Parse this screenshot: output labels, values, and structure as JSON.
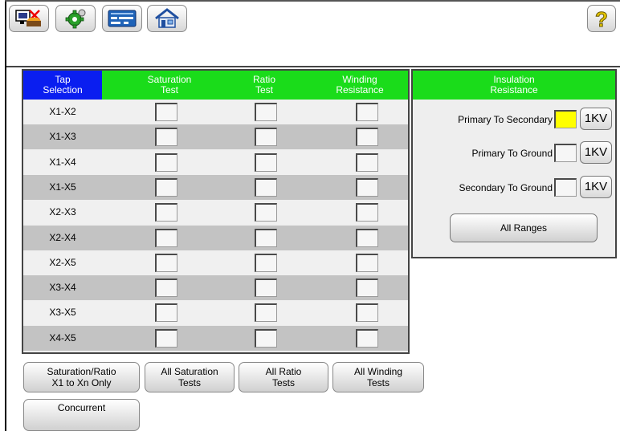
{
  "toolbar": {
    "buttons": [
      {
        "icon": "test-unit-icon"
      },
      {
        "icon": "gear-icon"
      },
      {
        "icon": "keyboard-icon"
      },
      {
        "icon": "home-icon"
      }
    ],
    "help_label": "?"
  },
  "grid": {
    "headers": {
      "tap": [
        "Tap",
        "Selection"
      ],
      "saturation": [
        "Saturation",
        "Test"
      ],
      "ratio": [
        "Ratio",
        "Test"
      ],
      "winding": [
        "Winding",
        "Resistance"
      ]
    },
    "rows": [
      "X1-X2",
      "X1-X3",
      "X1-X4",
      "X1-X5",
      "X2-X3",
      "X2-X4",
      "X2-X5",
      "X3-X4",
      "X3-X5",
      "X4-X5"
    ]
  },
  "insulation": {
    "header": [
      "Insulation",
      "Resistance"
    ],
    "rows": [
      {
        "label": "Primary To Secondary",
        "kv": "1KV",
        "highlight": true
      },
      {
        "label": "Primary To Ground",
        "kv": "1KV",
        "highlight": false
      },
      {
        "label": "Secondary To Ground",
        "kv": "1KV",
        "highlight": false
      }
    ],
    "all_ranges": "All Ranges"
  },
  "bottom_buttons": {
    "sat_ratio": [
      "Saturation/Ratio",
      "X1 to Xn Only"
    ],
    "all_saturation": [
      "All Saturation",
      "Tests"
    ],
    "all_ratio": [
      "All Ratio",
      "Tests"
    ],
    "all_winding": [
      "All Winding",
      "Tests"
    ],
    "concurrent": [
      "Concurrent"
    ]
  },
  "colors": {
    "header_blue": "#0a1ef0",
    "header_green": "#1adc1a",
    "row_light": "#f0f0f0",
    "row_dark": "#c3c3c3",
    "selected_yellow": "#ffff00"
  }
}
